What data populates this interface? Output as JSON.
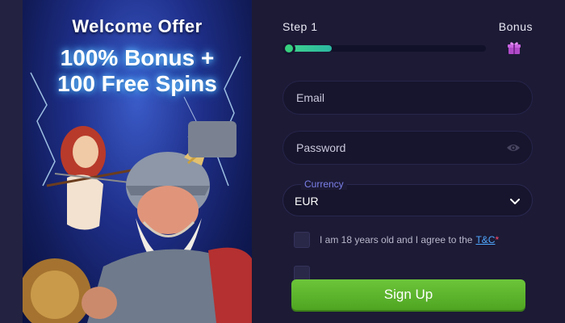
{
  "promo": {
    "title": "Welcome Offer",
    "headline_line1": "100% Bonus +",
    "headline_line2": "100 Free Spins"
  },
  "stepper": {
    "step_label": "Step 1",
    "bonus_label": "Bonus",
    "progress": 0.23,
    "bonus_icon": "gift-icon"
  },
  "form": {
    "email_placeholder": "Email",
    "password_placeholder": "Password",
    "password_icon": "eye-icon",
    "currency_label": "Currency",
    "currency_value": "EUR",
    "currency_icon": "chevron-down-icon",
    "terms_text": "I am 18 years old and I agree to the",
    "terms_link": "T&C",
    "terms_required": "*",
    "submit_label": "Sign Up"
  },
  "colors": {
    "accent_green": "#5bb52c",
    "progress_green": "#37d07e",
    "link_blue": "#4fa8ff",
    "label_purple": "#7c7fe8",
    "background": "#1c1a35"
  }
}
